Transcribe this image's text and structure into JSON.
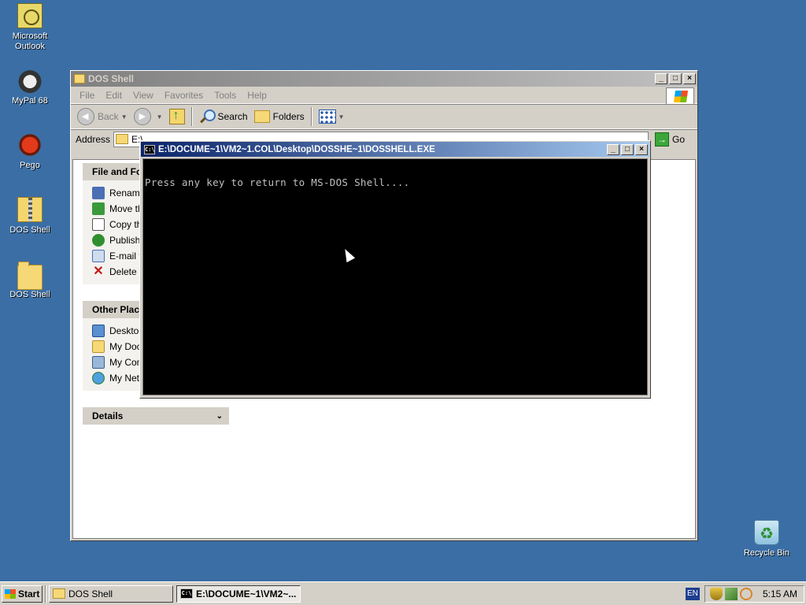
{
  "desktop": {
    "icons": [
      {
        "label": "Microsoft Outlook"
      },
      {
        "label": "MyPal 68"
      },
      {
        "label": "Pego"
      },
      {
        "label": "DOS Shell"
      },
      {
        "label": "DOS Shell"
      },
      {
        "label": "Recycle Bin"
      }
    ]
  },
  "explorer": {
    "title": "DOS Shell",
    "menu": [
      "File",
      "Edit",
      "View",
      "Favorites",
      "Tools",
      "Help"
    ],
    "toolbar": {
      "back": "Back",
      "search": "Search",
      "folders": "Folders"
    },
    "address": {
      "label": "Address",
      "value": "E:\\",
      "go": "Go"
    },
    "tasks_panel": {
      "title": "File and Fo",
      "items": [
        "Rename",
        "Move th",
        "Copy th",
        "Publish",
        "E-mail tl",
        "Delete t"
      ]
    },
    "places_panel": {
      "title": "Other Place",
      "items": [
        "Desktop",
        "My Docu",
        "My Com",
        "My Netv"
      ]
    },
    "details_panel": {
      "title": "Details"
    }
  },
  "console": {
    "title": "E:\\DOCUME~1\\VM2~1.COL\\Desktop\\DOSSHE~1\\DOSSHELL.EXE",
    "text": "Press any key to return to MS-DOS Shell...."
  },
  "taskbar": {
    "start": "Start",
    "tasks": [
      {
        "label": "DOS Shell",
        "active": false
      },
      {
        "label": "E:\\DOCUME~1\\VM2~...",
        "active": true
      }
    ],
    "lang": "EN",
    "clock": "5:15 AM"
  },
  "colors": {
    "desktop_bg": "#3a6ea5",
    "active_title": "#0a246a",
    "inactive_title": "#808080",
    "window_face": "#d4d0c8"
  }
}
